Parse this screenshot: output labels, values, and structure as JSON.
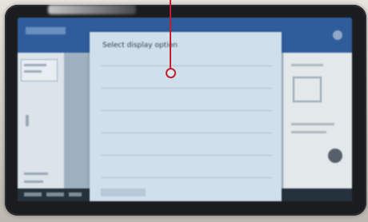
{
  "annotation": {
    "color": "#c21e2e"
  },
  "device": {
    "bezel_color": "#1b1c1f"
  },
  "modal": {
    "title": "Select display option",
    "rows": [
      "",
      "",
      "",
      "",
      "",
      ""
    ]
  },
  "app": {
    "header_color": "#2f5d9b",
    "footer_color": "#25313d"
  }
}
